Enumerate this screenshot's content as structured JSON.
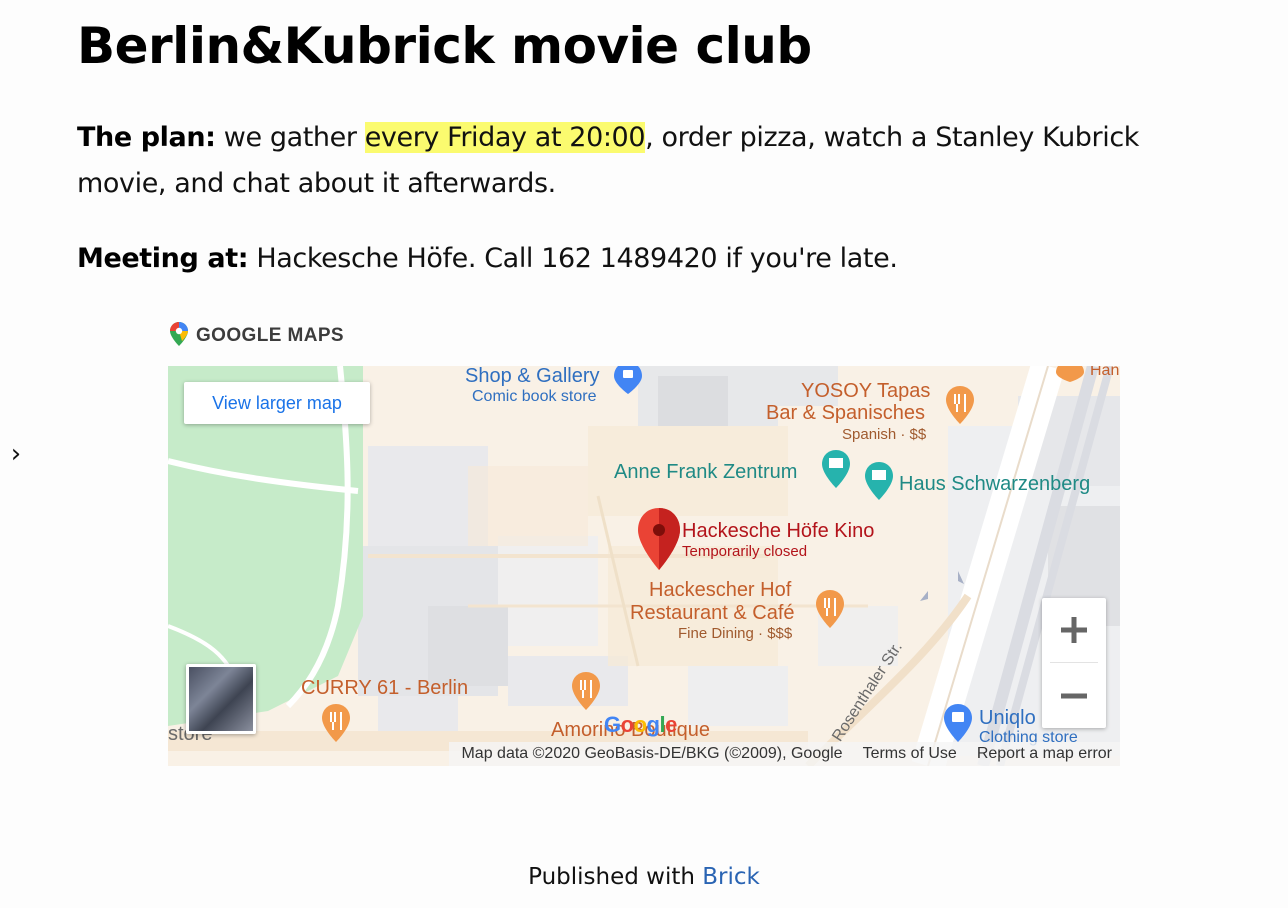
{
  "page": {
    "title": "Berlin&Kubrick movie club",
    "plan_label": "The plan:",
    "plan_before": " we gather ",
    "plan_highlight": "every Friday at 20:00",
    "plan_after": ", order pizza, watch a Stanley Kubrick movie, and chat about it afterwards.",
    "meeting_label": "Meeting at:",
    "meeting_text": " Hackesche Höfe. Call 162 1489420 if you're late.",
    "highlight_color": "#fbfb6f"
  },
  "side_toggle": {
    "icon": "chevron-right-icon",
    "glyph": "›"
  },
  "map_embed": {
    "header": "GOOGLE MAPS",
    "view_larger_label": "View larger map",
    "zoom_in_label": "+",
    "zoom_out_label": "−",
    "google_logo": "Google",
    "attribution": {
      "data": "Map data ©2020 GeoBasis-DE/BKG (©2009), Google",
      "terms": "Terms of Use",
      "report": "Report a map error"
    },
    "places": {
      "shop_gallery": {
        "name": "Shop & Gallery",
        "sub": "Comic book store"
      },
      "yosoy": {
        "name_line1": "YOSOY Tapas",
        "name_line2": "Bar & Spanisches",
        "sub": "Spanish · $$"
      },
      "anne_frank": {
        "name": "Anne Frank Zentrum"
      },
      "schwarzenberg": {
        "name": "Haus Schwarzenberg"
      },
      "kino": {
        "name": "Hackesche Höfe Kino",
        "sub": "Temporarily closed"
      },
      "hackescher_hof": {
        "name_line1": "Hackescher Hof",
        "name_line2": "Restaurant & Café",
        "sub": "Fine Dining · $$$"
      },
      "curry": {
        "name": "CURRY 61 - Berlin"
      },
      "amorino": {
        "name": "Amorino Boutique"
      },
      "uniqlo": {
        "name": "Uniqlo",
        "sub": "Clothing store"
      },
      "street": {
        "name": "Rosenthaler Str."
      },
      "store_partial": {
        "name": "store"
      },
      "han_partial": {
        "name": "Han"
      }
    },
    "colors": {
      "teal": "#1f8a85",
      "blue": "#2f6fc0",
      "orange": "#c45f2c",
      "red": "#b3141b",
      "park": "#c6ebc9"
    }
  },
  "footer": {
    "prefix": "Published with ",
    "link": "Brick"
  }
}
